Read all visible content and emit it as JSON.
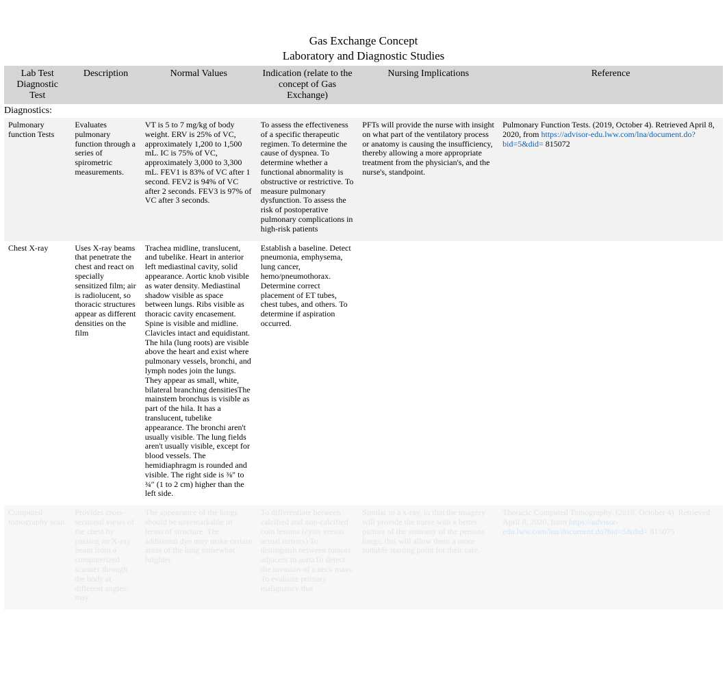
{
  "title": "Gas Exchange Concept",
  "subtitle": "Laboratory and Diagnostic Studies",
  "columns": [
    "Lab Test Diagnostic Test",
    "Description",
    "Normal Values",
    "Indication (relate to the concept of Gas Exchange)",
    "Nursing Implications",
    "Reference"
  ],
  "section_heading": "Diagnostics:",
  "rows": [
    {
      "test": "Pulmonary function Tests",
      "description": "Evaluates pulmonary function through a series of spirometric measurements.",
      "normal": "VT is 5 to 7 mg/kg of body weight.  ERV is 25% of VC, approximately 1,200 to 1,500 mL.\nIC is 75% of VC, approximately 3,000 to 3,300 mL.\nFEV1 is 83% of VC after 1 second.\nFEV2 is 94% of VC after 2 seconds.\nFEV3 is 97% of VC after 3 seconds.",
      "indication": "To assess the effectiveness of a specific therapeutic regimen.   To determine the cause of dyspnea.   To determine whether a functional abnormality is obstructive or restrictive.   To measure pulmonary dysfunction.  To assess the risk of postoperative pulmonary complications in high-risk patients",
      "nursing": "PFTs will provide the nurse with insight on what part of the ventilatory process or anatomy is causing the insufficiency, thereby allowing a more appropriate treatment from the physician's, and the nurse's, standpoint.",
      "reference_pre": "Pulmonary Function Tests. (2019, October 4). Retrieved April 8, 2020, from ",
      "reference_link": "https://advisor-edu.lww.com/lna/document.do?bid=5&did=",
      "reference_post": " 815072"
    },
    {
      "test": "Chest X-ray",
      "description": "Uses X-ray beams that penetrate the chest and react on specially sensitized film; air is radiolucent, so thoracic structures appear as different densities on the film",
      "normal": "Trachea midline, translucent, and tubelike.  Heart in anterior left mediastinal cavity, solid appearance.   Aortic knob visible as water density.   Mediastinal shadow visible as space between lungs.  Ribs visible as thoracic cavity encasement.   Spine is visible and midline.  Clavicles intact and equidistant.   The hila (lung roots) are visible above the heart and exist where pulmonary vessels, bronchi, and lymph nodes join the lungs. They appear as small, white, bilateral branching densitiesThe mainstem bronchus is visible as part of the hila. It has a translucent, tubelike appearance.  The bronchi aren't usually visible.  The lung fields aren't usually visible, except for blood vessels.  The hemidiaphragm is rounded and visible. The right side is ⅜″ to ¾″ (1 to 2 cm) higher than the left side.",
      "indication": "Establish a baseline.  Detect pneumonia, emphysema, lung cancer, hemo/pneumothorax.  Determine correct placement of ET tubes, chest tubes, and others.   To determine if aspiration occurred.",
      "nursing": "",
      "reference_pre": "",
      "reference_link": "",
      "reference_post": ""
    },
    {
      "test": "Computed tomography scan",
      "description": "Provides cross-sectional views of the chest by passing an X-ray beam from a computerized scanner through the body at different angles; may",
      "normal": "The appearance of the lungs should be unremarkable in terms of structure.  The additional dye may make certain areas of the lung somewhat brighter.",
      "indication": "To differentiate between calcified and non-calcified coin lesions (cysts versus actual tumors)   To distinguish between tumors adjacent to aortaTo detect the invasion of a neck mass.  To evaluate primary malignancy that",
      "nursing": "Similar to a x-ray, in that the imagery will provide the nurse with a better picture of the anatomy of the persons lungs; this will allow them a more suitable starting point for their care.",
      "reference_pre": "Thoracic Computed Tomography. (2019, October 4). Retrieved April 8, 2020, from ",
      "reference_link": "https://advisor-edu.lww.com/lna/document.do?bid=5&did=",
      "reference_post": " 815075"
    }
  ]
}
